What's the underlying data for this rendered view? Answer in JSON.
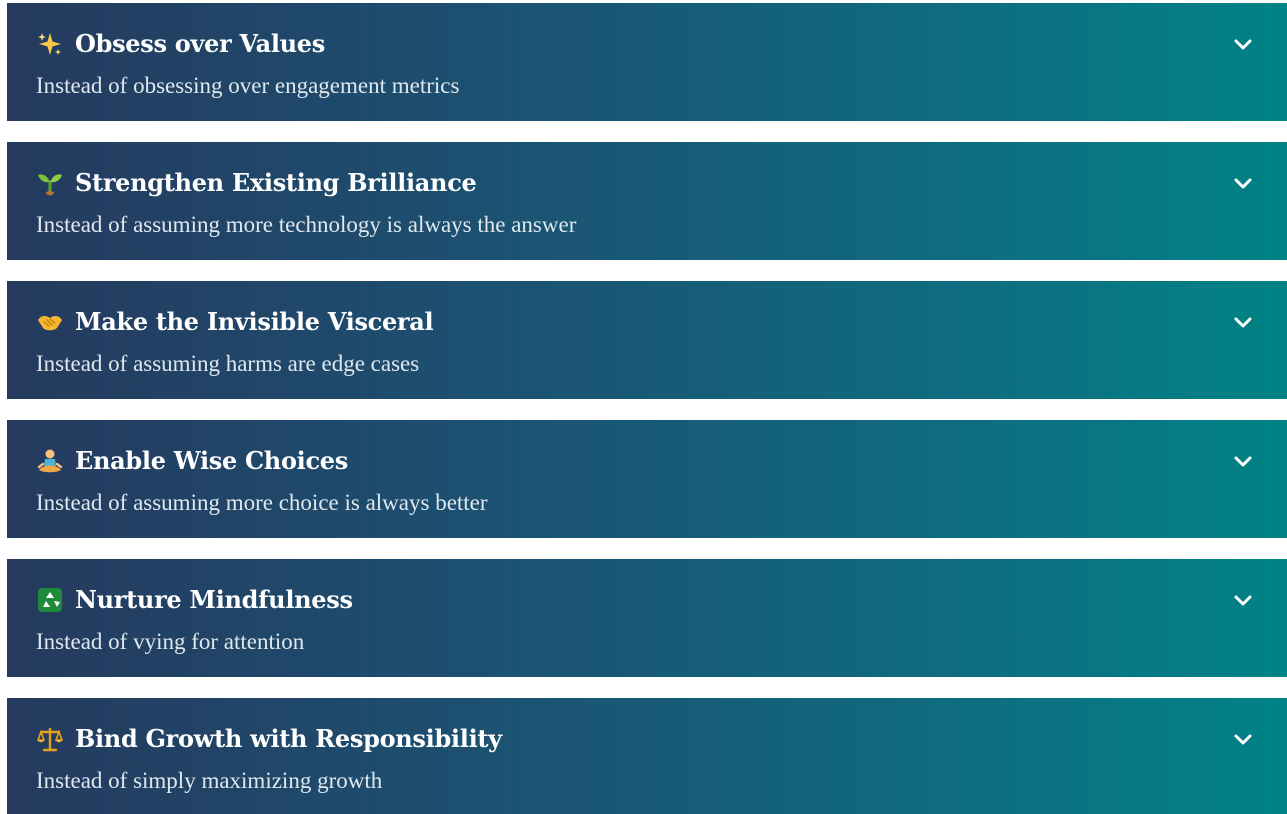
{
  "items": [
    {
      "title": "Obsess over Values",
      "subtitle": "Instead of obsessing over engagement metrics",
      "icon": "sparkles-icon"
    },
    {
      "title": "Strengthen Existing Brilliance",
      "subtitle": "Instead of assuming more technology is always the answer",
      "icon": "seedling-icon"
    },
    {
      "title": "Make the Invisible Visceral",
      "subtitle": "Instead of assuming harms are edge cases",
      "icon": "handshake-icon"
    },
    {
      "title": "Enable Wise Choices",
      "subtitle": "Instead of assuming more choice is always better",
      "icon": "meditating-person-icon"
    },
    {
      "title": "Nurture Mindfulness",
      "subtitle": "Instead of vying for attention",
      "icon": "recycle-icon"
    },
    {
      "title": "Bind Growth with Responsibility",
      "subtitle": "Instead of simply maximizing growth",
      "icon": "balance-scale-icon"
    }
  ],
  "colors": {
    "gradient_start": "#253a5e",
    "gradient_end": "#008385",
    "title_text": "#ffffff",
    "subtitle_text": "#dfe8ee"
  }
}
